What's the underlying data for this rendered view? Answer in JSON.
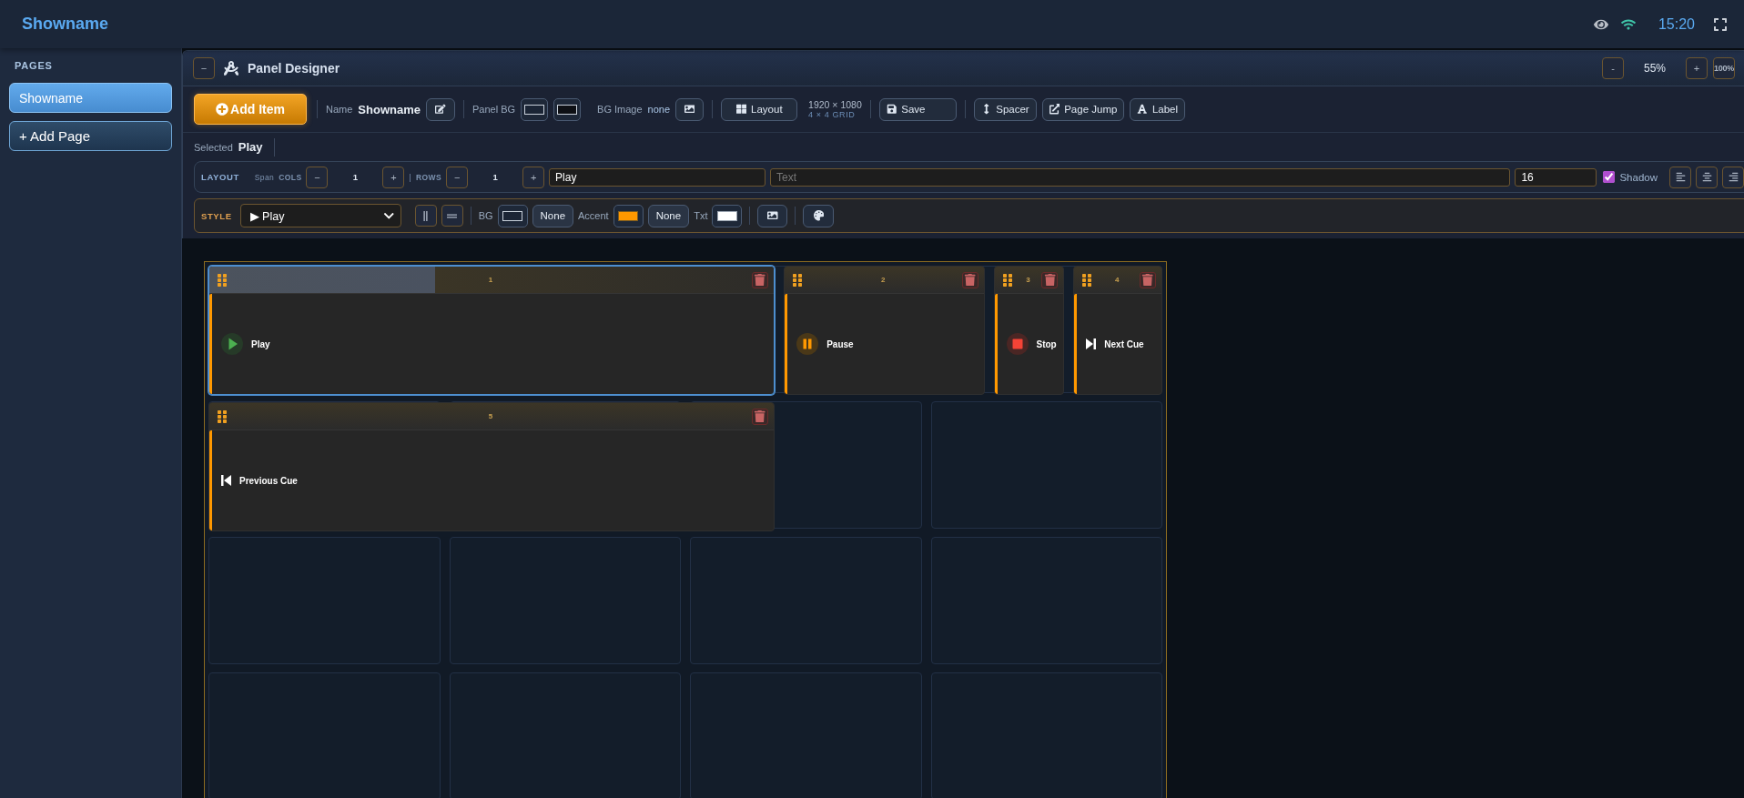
{
  "header": {
    "title": "Showname",
    "time": "15:20"
  },
  "sidebar": {
    "heading": "PAGES",
    "pages": [
      {
        "label": "Showname",
        "selected": true
      }
    ],
    "add_page": "+ Add Page"
  },
  "designer": {
    "collapse": "−",
    "title": "Panel Designer",
    "zoom_out": "-",
    "zoom": "55%",
    "zoom_in": "+",
    "zoom_reset": "100%"
  },
  "toolbar": {
    "add_item": "Add Item",
    "name_label": "Name",
    "name": "Showname",
    "panel_bg_label": "Panel BG",
    "panel_bg": [
      {
        "color": "#1b2535"
      },
      {
        "color": "#0e1014"
      }
    ],
    "bg_image_label": "BG Image",
    "bg_image": "none",
    "layout": "Layout",
    "resolution": "1920 × 1080",
    "grid": "4 × 4 GRID",
    "save": "Save",
    "inserts": [
      {
        "kind": "spacer",
        "label": "Spacer"
      },
      {
        "kind": "jump",
        "label": "Page Jump"
      },
      {
        "kind": "label",
        "label": "Label"
      }
    ]
  },
  "selection": {
    "label": "Selected",
    "value": "Play"
  },
  "layout_row": {
    "heading": "LAYOUT",
    "span": "Span",
    "cols": "COLS",
    "cols_minus": "−",
    "cols_value": "1",
    "cols_plus": "+",
    "divider": "|",
    "rows": "ROWS",
    "rows_minus": "−",
    "rows_value": "1",
    "rows_plus": "+",
    "label_value": "Play",
    "text_placeholder": "Text",
    "font_size": "16",
    "shadow_label": "Shadow",
    "shadow": true,
    "align": [
      {
        "kind": "left"
      },
      {
        "kind": "center"
      },
      {
        "kind": "right"
      }
    ]
  },
  "style_row": {
    "heading": "STYLE",
    "icon_select": "▶ Play",
    "arrange": [
      {
        "kind": "vertical"
      },
      {
        "kind": "horizontal"
      }
    ],
    "colors": [
      {
        "label": "BG",
        "color": "#1b2535",
        "reset": "None"
      },
      {
        "label": "Accent",
        "color": "#ff9800",
        "reset": "None"
      },
      {
        "label": "Txt",
        "color": "#ffffff"
      }
    ]
  },
  "canvas": {
    "items": [
      {
        "number": "1",
        "kind": "play",
        "label": "Play",
        "selected": true
      },
      {
        "number": "2",
        "kind": "pause",
        "label": "Pause",
        "selected": false
      },
      {
        "number": "3",
        "kind": "stop",
        "label": "Stop",
        "selected": false
      },
      {
        "number": "4",
        "kind": "next",
        "label": "Next Cue",
        "selected": false
      },
      {
        "number": "5",
        "kind": "previous",
        "label": "Previous Cue",
        "selected": false
      }
    ]
  }
}
